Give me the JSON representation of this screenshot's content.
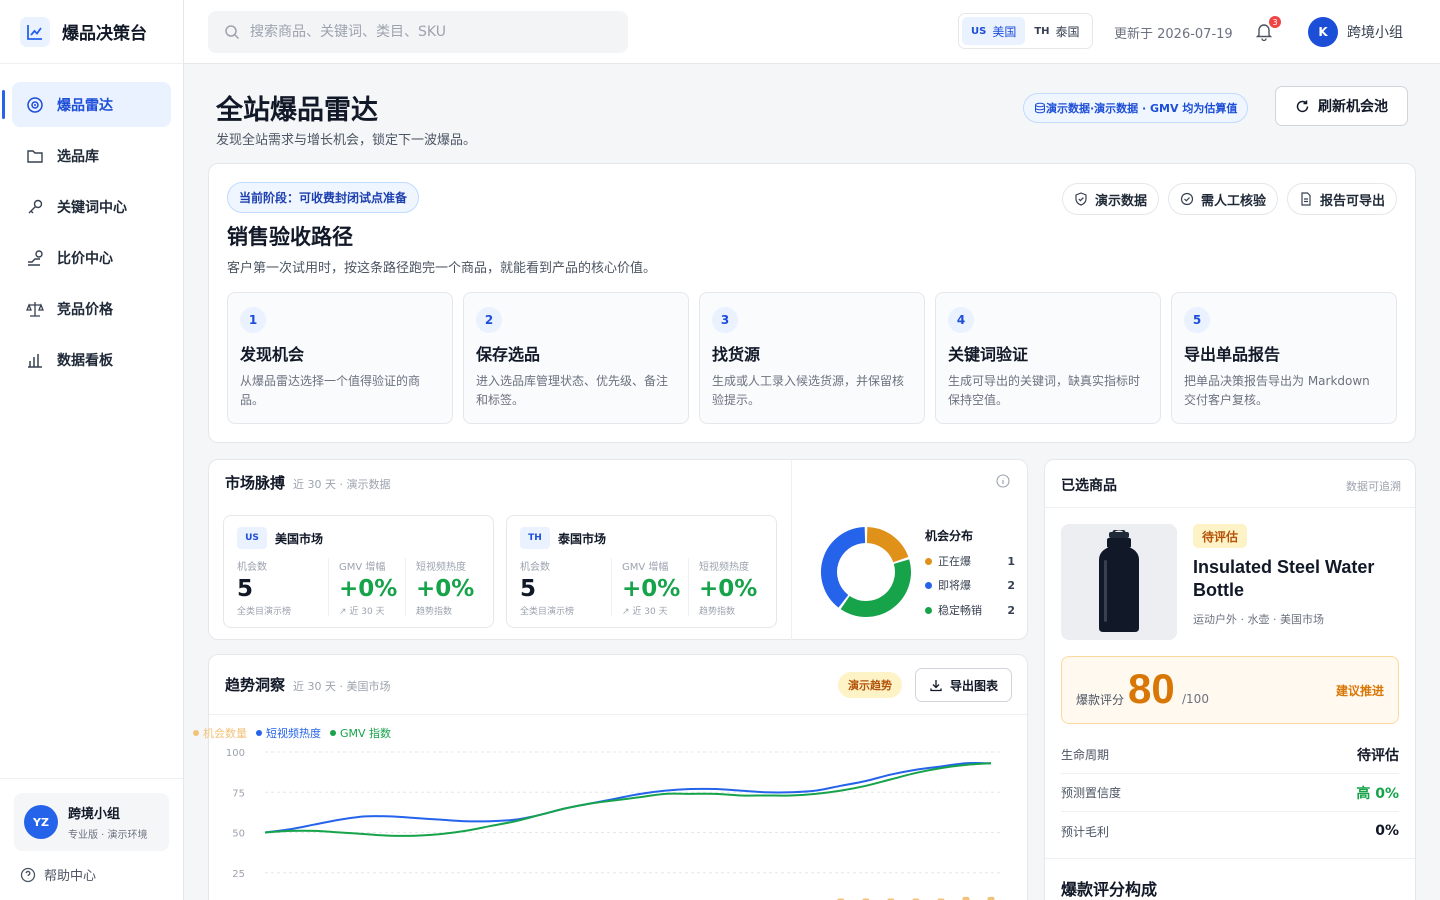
{
  "brand": {
    "title": "爆品决策台"
  },
  "sidebar": {
    "items": [
      {
        "label": "爆品雷达",
        "icon": "radar-icon",
        "active": true
      },
      {
        "label": "选品库",
        "icon": "folder-icon"
      },
      {
        "label": "关键词中心",
        "icon": "key-icon"
      },
      {
        "label": "比价中心",
        "icon": "compare-icon"
      },
      {
        "label": "竞品价格",
        "icon": "scale-icon"
      },
      {
        "label": "数据看板",
        "icon": "bar-chart-icon"
      }
    ],
    "user": {
      "initials": "YZ",
      "name": "跨境小组",
      "plan": "专业版 · 演示环境"
    },
    "help": "帮助中心"
  },
  "topbar": {
    "search_placeholder": "搜索商品、关键词、类目、SKU",
    "markets": [
      {
        "code": "US",
        "label": "美国",
        "active": true
      },
      {
        "code": "TH",
        "label": "泰国"
      }
    ],
    "updated": "更新于 2026-07-19",
    "notifications": "3",
    "user": {
      "initial": "K",
      "name": "跨境小组"
    }
  },
  "page": {
    "title": "全站爆品雷达",
    "subtitle": "发现全站需求与增长机会，锁定下一波爆品。",
    "demo_pill": "演示数据·演示数据 · GMV 均为估算值",
    "refresh": "刷新机会池"
  },
  "path": {
    "stage": "当前阶段：可收费封闭试点准备",
    "tags": [
      "演示数据",
      "需人工核验",
      "报告可导出"
    ],
    "title": "销售验收路径",
    "desc": "客户第一次试用时，按这条路径跑完一个商品，就能看到产品的核心价值。",
    "steps": [
      {
        "num": "1",
        "title": "发现机会",
        "desc": "从爆品雷达选择一个值得验证的商品。"
      },
      {
        "num": "2",
        "title": "保存选品",
        "desc": "进入选品库管理状态、优先级、备注和标签。"
      },
      {
        "num": "3",
        "title": "找货源",
        "desc": "生成或人工录入候选货源，并保留核验提示。"
      },
      {
        "num": "4",
        "title": "关键词验证",
        "desc": "生成可导出的关键词，缺真实指标时保持空值。"
      },
      {
        "num": "5",
        "title": "导出单品报告",
        "desc": "把单品决策报告导出为 Markdown 交付客户复核。"
      }
    ]
  },
  "pulse": {
    "title": "市场脉搏",
    "sub": "近 30 天 · 演示数据",
    "markets": [
      {
        "code": "US",
        "name": "美国市场",
        "m1_label": "机会数",
        "m1": "5",
        "m1_foot": "全类目演示榜",
        "m2_label": "GMV 增幅",
        "m2": "+0%",
        "m2_foot": "↗ 近 30 天",
        "m3_label": "短视频热度",
        "m3": "+0%",
        "m3_foot": "趋势指数"
      },
      {
        "code": "TH",
        "name": "泰国市场",
        "m1_label": "机会数",
        "m1": "5",
        "m1_foot": "全类目演示榜",
        "m2_label": "GMV 增幅",
        "m2": "+0%",
        "m2_foot": "↗ 近 30 天",
        "m3_label": "短视频热度",
        "m3": "+0%",
        "m3_foot": "趋势指数"
      }
    ],
    "distribution": {
      "title": "机会分布",
      "items": [
        {
          "label": "正在爆",
          "count": "1",
          "value": 1,
          "color": "#e0911a"
        },
        {
          "label": "即将爆",
          "count": "2",
          "value": 2,
          "color": "#2563eb"
        },
        {
          "label": "稳定畅销",
          "count": "2",
          "value": 2,
          "color": "#16a34a"
        }
      ]
    }
  },
  "trend": {
    "title": "趋势洞察",
    "sub": "近 30 天 · 美国市场",
    "tag": "演示趋势",
    "export": "导出图表"
  },
  "chart_data": {
    "type": "line",
    "y_ticks": [
      "100",
      "75",
      "50",
      "25"
    ],
    "ylim": [
      0,
      100
    ],
    "series": [
      {
        "name": "机会数量",
        "kind": "bar",
        "color": "#f3c27a",
        "values": [
          8,
          8,
          8,
          8,
          8,
          8,
          8,
          8,
          8,
          8,
          8,
          8,
          8,
          8,
          8,
          8,
          8,
          8,
          8,
          8,
          8,
          8,
          8,
          9,
          9,
          9,
          9,
          9,
          10,
          10
        ]
      },
      {
        "name": "短视频热度",
        "kind": "line",
        "color": "#2563eb",
        "values": [
          50,
          52,
          55,
          58,
          60,
          60,
          59,
          58,
          57,
          57,
          58,
          61,
          65,
          68,
          71,
          74,
          76,
          77,
          77,
          76,
          75,
          75,
          76,
          79,
          82,
          86,
          89,
          91,
          93,
          93
        ]
      },
      {
        "name": "GMV 指数",
        "kind": "line",
        "color": "#16a34a",
        "values": [
          50,
          51,
          51,
          50,
          49,
          48,
          48,
          49,
          51,
          54,
          57,
          61,
          65,
          68,
          70,
          72,
          74,
          74,
          74,
          73,
          73,
          73,
          74,
          76,
          79,
          83,
          87,
          90,
          92,
          93
        ]
      }
    ]
  },
  "selected": {
    "title": "已选商品",
    "note": "数据可追溯",
    "status": "待评估",
    "name": "Insulated Steel Water Bottle",
    "meta": "运动户外 · 水壶 · 美国市场",
    "score_label": "爆款评分",
    "score": "80",
    "score_den": "/100",
    "score_action": "建议推进",
    "rows": [
      {
        "label": "生命周期",
        "value": "待评估"
      },
      {
        "label": "预测置信度",
        "value": "高 0%"
      },
      {
        "label": "预计毛利",
        "value": "0%"
      }
    ],
    "section": "爆款评分构成"
  }
}
